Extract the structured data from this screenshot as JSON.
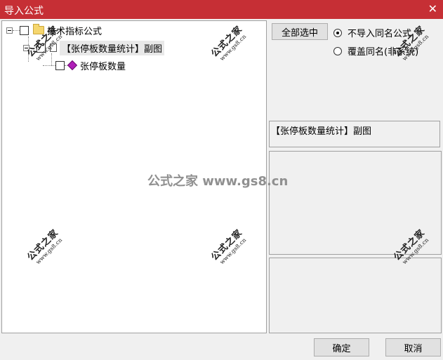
{
  "window": {
    "title": "导入公式",
    "close_glyph": "✕"
  },
  "tree": {
    "root_label": "技术指标公式",
    "child_label": "【张停板数量统计】副图",
    "leaf_label": "张停板数量"
  },
  "buttons": {
    "select_all": "全部选中",
    "ok": "确定",
    "cancel": "取消"
  },
  "options": {
    "skip_duplicate": "不导入同名公式",
    "overwrite_duplicate": "覆盖同名(非系统)",
    "selected": "skip_duplicate"
  },
  "info_text": "【张停板数量统计】副图",
  "watermark": {
    "cn": "公式之家",
    "url": "www.gs8.cn",
    "center": "公式之家 www.gs8.cn"
  }
}
